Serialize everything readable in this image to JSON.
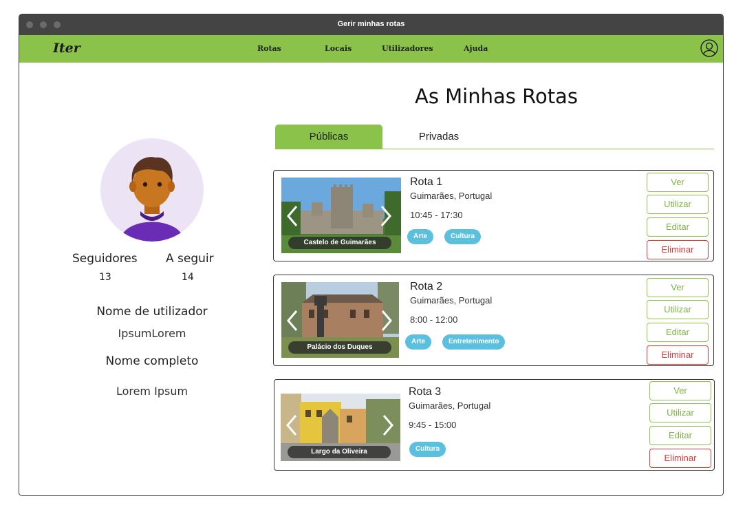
{
  "window": {
    "title": "Gerir minhas rotas"
  },
  "nav": {
    "logo": "Iter",
    "items": [
      "Rotas",
      "Locais",
      "Utilizadores",
      "Ajuda"
    ]
  },
  "page": {
    "title": "As Minhas Rotas"
  },
  "tabs": [
    {
      "label": "Públicas",
      "active": true
    },
    {
      "label": "Privadas",
      "active": false
    }
  ],
  "profile": {
    "followers_label": "Seguidores",
    "followers": "13",
    "following_label": "A seguir",
    "following": "14",
    "username_label": "Nome de utilizador",
    "username": "IpsumLorem",
    "fullname_label": "Nome completo",
    "fullname": "Lorem Ipsum"
  },
  "routes": [
    {
      "title": "Rota 1",
      "location": "Guimarães, Portugal",
      "time": "10:45 - 17:30",
      "image_caption": "Castelo de Guimarães",
      "tags": [
        "Arte",
        "Cultura"
      ]
    },
    {
      "title": "Rota 2",
      "location": "Guimarães, Portugal",
      "time": "8:00 - 12:00",
      "image_caption": "Palácio dos Duques",
      "tags": [
        "Arte",
        "Entretenimento"
      ]
    },
    {
      "title": "Rota 3",
      "location": "Guimarães, Portugal",
      "time": "9:45 - 15:00",
      "image_caption": "Largo da Oliveira",
      "tags": [
        "Cultura"
      ]
    }
  ],
  "actions": {
    "view": "Ver",
    "use": "Utilizar",
    "edit": "Editar",
    "delete": "Eliminar"
  },
  "colors": {
    "accent": "#8bc34a",
    "tag": "#5bc0de",
    "danger": "#e53935",
    "titlebar": "#444444"
  }
}
